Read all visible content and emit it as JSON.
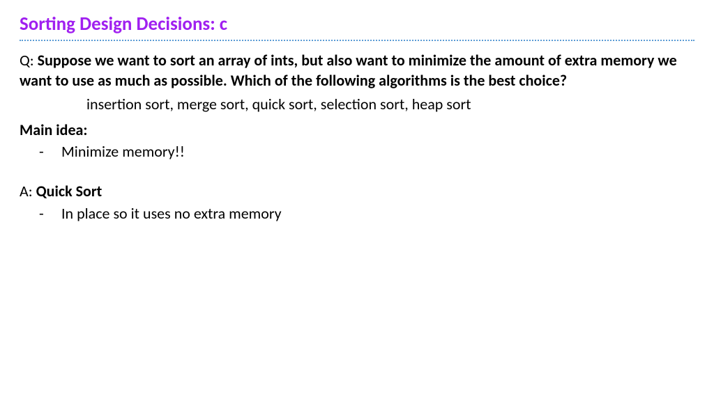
{
  "title": "Sorting Design Decisions: c",
  "question": {
    "prefix": "Q: ",
    "text": "Suppose we want to sort an array of ints, but also want to minimize the amount of extra memory we want to use as much as possible. Which of the following algorithms is the best choice?"
  },
  "options": "insertion sort, merge sort, quick sort, selection sort, heap sort",
  "main_idea_label": "Main idea:",
  "main_idea_items": [
    "Minimize memory!!"
  ],
  "answer": {
    "prefix": "A: ",
    "text": "Quick Sort"
  },
  "answer_items": [
    "In place so it uses no extra memory"
  ]
}
